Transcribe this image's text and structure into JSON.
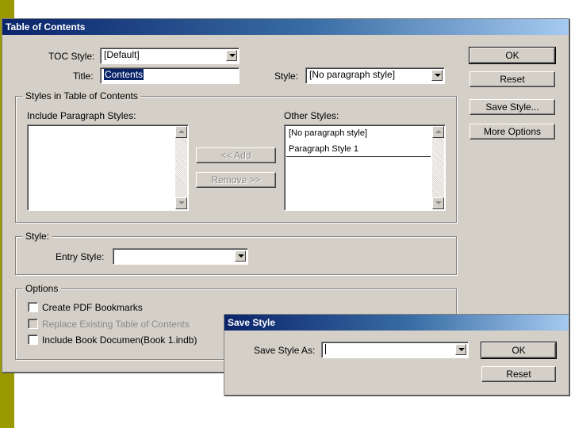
{
  "toc_dialog": {
    "title": "Table of Contents",
    "toc_style_label": "TOC Style:",
    "toc_style_value": "[Default]",
    "title_label": "Title:",
    "title_value": "Contents",
    "style_label": "Style:",
    "style_value": "[No paragraph style]",
    "group_styles_title": "Styles in Table of Contents",
    "include_label": "Include Paragraph Styles:",
    "other_label": "Other Styles:",
    "add_button": "<< Add",
    "remove_button": "Remove >>",
    "other_styles": [
      "[No paragraph style]",
      "Paragraph Style 1"
    ],
    "style_group_title": "Style:",
    "entry_style_label": "Entry Style:",
    "entry_style_value": "",
    "options_group_title": "Options",
    "opt_pdf_bookmarks": "Create PDF Bookmarks",
    "opt_replace": "Replace Existing Table of Contents",
    "opt_include_book": "Include Book Documen(Book 1.indb)",
    "ok_button": "OK",
    "reset_button": "Reset",
    "save_style_button": "Save Style...",
    "more_options_button": "More Options"
  },
  "save_dialog": {
    "title": "Save Style",
    "save_as_label": "Save Style As:",
    "save_as_value": "",
    "ok_button": "OK",
    "reset_button": "Reset"
  },
  "colors": {
    "dialog_bg": "#d4d0c8",
    "titlebar_start": "#0a246a",
    "titlebar_end": "#a6caf0",
    "slide_accent": "#9a9a00"
  }
}
